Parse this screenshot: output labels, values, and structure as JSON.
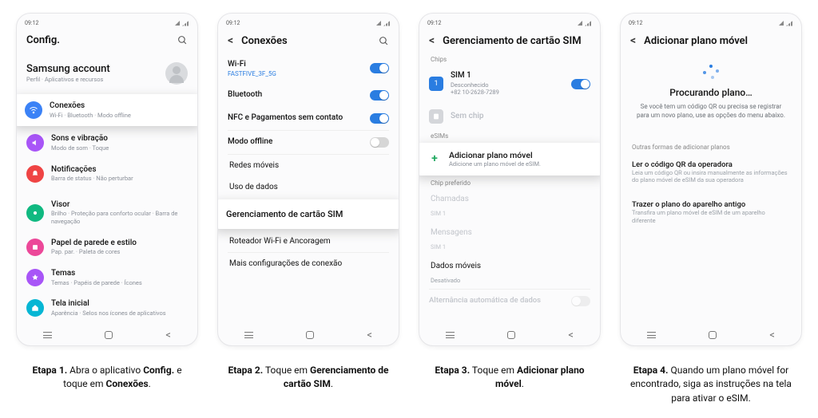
{
  "common": {
    "time": "09:12",
    "nav_back_glyph": "<"
  },
  "step1": {
    "header": "Config.",
    "account": {
      "title": "Samsung account",
      "sub": "Perfil · Aplicativos e recursos"
    },
    "connections": {
      "title": "Conexões",
      "sub": "Wi-Fi · Bluetooth · Modo offline"
    },
    "sound": {
      "title": "Sons e vibração",
      "sub": "Modo de som · Toque"
    },
    "notif": {
      "title": "Notificações",
      "sub": "Barra de status · Não perturbar"
    },
    "display": {
      "title": "Visor",
      "sub": "Brilho · Proteção para conforto ocular · Barra de navegação"
    },
    "wallpaper": {
      "title": "Papel de parede e estilo",
      "sub": "Pap. par. · Paleta de cores"
    },
    "themes": {
      "title": "Temas",
      "sub": "Temas · Papéis de parede · Ícones"
    },
    "home": {
      "title": "Tela inicial",
      "sub": "Aparência · Selos nos ícones de aplicativos"
    },
    "caption_step": "Etapa 1.",
    "caption": "Abra o aplicativo Config. e toque em Conexões."
  },
  "step2": {
    "header": "Conexões",
    "wifi": {
      "title": "Wi-Fi",
      "sub": "FASTFIVE_3F_5G"
    },
    "bt": "Bluetooth",
    "nfc": "NFC e Pagamentos sem contato",
    "offline": "Modo offline",
    "mobileNet": "Redes móveis",
    "dataUsage": "Uso de dados",
    "sim": "Gerenciamento de cartão SIM",
    "tether": "Roteador Wi-Fi e Ancoragem",
    "more": "Mais configurações de conexão",
    "caption_step": "Etapa 2.",
    "caption": "Toque em Gerenciamento de cartão SIM."
  },
  "step3": {
    "header": "Gerenciamento de cartão SIM",
    "sec_chips": "Chips",
    "sim1": {
      "title": "SIM 1",
      "sub1": "Desconhecido",
      "sub2": "+82 10-2628-7289"
    },
    "noChip": "Sem chip",
    "sec_esims": "eSIMs",
    "addPlan": {
      "title": "Adicionar plano móvel",
      "sub": "Adicione um plano móvel de eSIM."
    },
    "sec_pref": "Chip preferido",
    "calls": {
      "title": "Chamadas",
      "sub": "SIM 1"
    },
    "msgs": {
      "title": "Mensagens",
      "sub": "SIM 1"
    },
    "data": {
      "title": "Dados móveis",
      "sub": "Desativado"
    },
    "autoSwitch": "Alternância automática de dados",
    "caption_step": "Etapa 3.",
    "caption": "Toque em Adicionar plano móvel."
  },
  "step4": {
    "header": "Adicionar plano móvel",
    "searching": "Procurando plano…",
    "desc": "Se você tem um código QR ou precisa se registrar para um novo plano, use as opções do menu abaixo.",
    "sec_other": "Outras formas de adicionar planos",
    "qr": {
      "title": "Ler o código QR da operadora",
      "sub": "Leia um código QR ou insira manualmente as informações do plano móvel de eSIM da sua operadora"
    },
    "transfer": {
      "title": "Trazer o plano do aparelho antigo",
      "sub": "Transfira um plano móvel de eSIM de um aparelho diferente"
    },
    "caption_step": "Etapa 4.",
    "caption": "Quando um plano móvel for encontrado, siga as instruções na tela para ativar o eSIM."
  }
}
